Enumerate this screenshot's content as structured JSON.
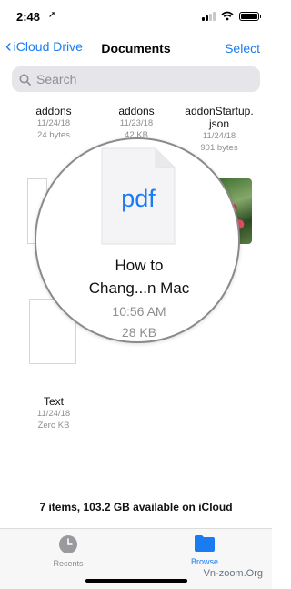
{
  "status": {
    "time": "2:48",
    "arrow": "➚"
  },
  "nav": {
    "back_label": "iCloud Drive",
    "title": "Documents",
    "select_label": "Select"
  },
  "search": {
    "placeholder": "Search"
  },
  "files": [
    {
      "name": "addons",
      "date": "11/24/18",
      "size": "24 bytes"
    },
    {
      "name": "addons",
      "date": "11/23/18",
      "size": "42 KB"
    },
    {
      "name_line1": "addonStartup.",
      "name_line2": "json",
      "date": "11/24/18",
      "size": "901 bytes"
    },
    {
      "name": "Text",
      "date": "11/24/18",
      "size": "Zero KB"
    }
  ],
  "magnified": {
    "icon_text": "pdf",
    "name_line1": "How to",
    "name_line2": "Chang...n Mac",
    "time": "10:56 AM",
    "size": "28 KB"
  },
  "footer": {
    "info": "7 items, 103.2 GB available on iCloud"
  },
  "tabs": [
    {
      "label": "Recents"
    },
    {
      "label": "Browse"
    }
  ],
  "colors": {
    "accent": "#1a7cf0",
    "secondary_text": "#8e8e93"
  },
  "watermark": "Vn-zoom.Org"
}
